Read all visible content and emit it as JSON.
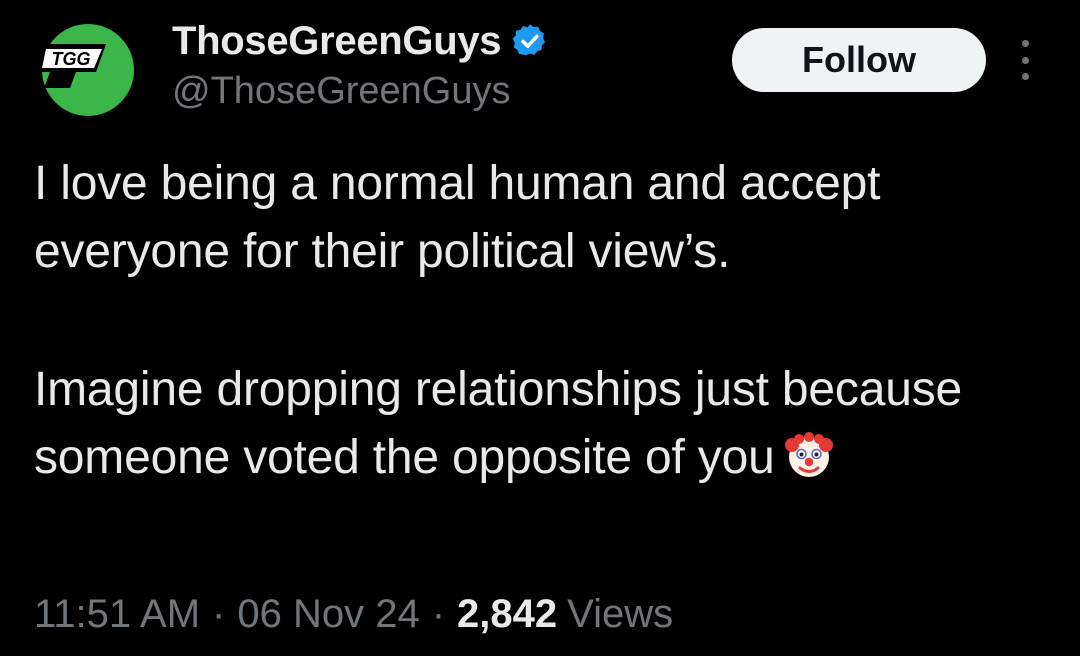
{
  "author": {
    "display_name": "ThoseGreenGuys",
    "handle": "@ThoseGreenGuys",
    "verified": true,
    "avatar_icon": "tgg-logo-icon",
    "avatar_text": "TGG"
  },
  "actions": {
    "follow_label": "Follow",
    "more_icon": "more-vertical-icon"
  },
  "tweet": {
    "paragraph_1": "I love being a normal human and accept everyone for their political view’s.",
    "paragraph_2": "Imagine dropping relationships just because someone voted the opposite of you",
    "emoji_icon": "clown-face-icon"
  },
  "meta": {
    "time": "11:51 AM",
    "date": "06 Nov 24",
    "separator": "·",
    "views_count": "2,842",
    "views_label": "Views"
  },
  "colors": {
    "background": "#000000",
    "text_primary": "#e7e9ea",
    "text_secondary": "#71767b",
    "verified_blue": "#1d9bf0",
    "follow_bg": "#eff3f4",
    "brand_green": "#3cb54a"
  }
}
